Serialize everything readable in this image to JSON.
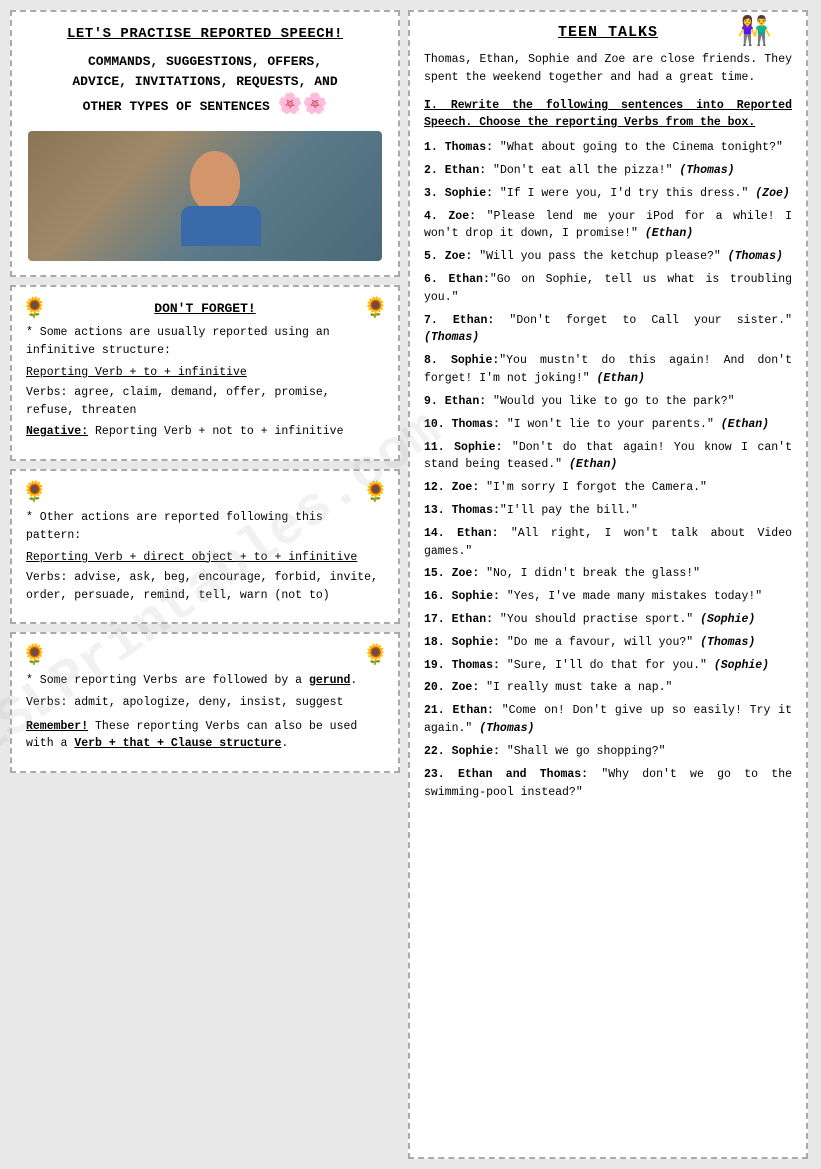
{
  "left": {
    "title": "LET'S PRACTISE REPORTED SPEECH!",
    "subtitle_line1": "COMMANDS, SUGGESTIONS, OFFERS,",
    "subtitle_line2": "ADVICE, INVITATIONS, REQUESTS, AND",
    "subtitle_line3": "OTHER TYPES OF SENTENCES",
    "flowers": "🌸🌸",
    "box1": {
      "title": "DON'T FORGET!",
      "icon": "🌻",
      "para1": "* Some actions are usually reported using an infinitive structure:",
      "rule1": "Reporting Verb + to + infinitive",
      "verbs1": "Verbs: agree, claim, demand, offer, promise, refuse, threaten",
      "negative": "Negative: Reporting Verb +  not to + infinitive"
    },
    "box2": {
      "icon": "🌻",
      "para1": "* Other actions are reported following this pattern:",
      "rule1": "Reporting Verb + direct object + to + infinitive",
      "verbs1": "Verbs: advise, ask, beg, encourage, forbid, invite, order, persuade, remind, tell, warn (not to)"
    },
    "box3": {
      "icon": "🌻",
      "para1": "* Some reporting Verbs are followed by a gerund.",
      "verbs1": "Verbs: admit, apologize, deny, insist, suggest",
      "note": "Remember! These reporting Verbs can also be used with a Verb + that + Clause structure."
    }
  },
  "right": {
    "title": "TEEN TALKS",
    "icon": "👫",
    "intro": "Thomas, Ethan, Sophie and Zoe are close friends. They spent the weekend together and had a great time.",
    "instruction": "I.  Rewrite the following sentences into Reported Speech. Choose the reporting Verbs from the box.",
    "sentences": [
      {
        "num": "1.",
        "speaker": "Thomas:",
        "text": " \"What about going to the Cinema tonight?\""
      },
      {
        "num": "2.",
        "speaker": "Ethan:",
        "text": "  \"Don't eat all the pizza!\" ",
        "recipient": "(Thomas)"
      },
      {
        "num": "3.",
        "speaker": "Sophie:",
        "text": "  \"If I were you, I'd try this dress.\" ",
        "recipient": "(Zoe)"
      },
      {
        "num": "4.",
        "speaker": "Zoe:",
        "text": "  \"Please lend me your iPod for a while! I won't drop it down, I promise!\" ",
        "recipient": "(Ethan)"
      },
      {
        "num": "5.",
        "speaker": "Zoe:",
        "text": "  \"Will you pass the ketchup please?\" ",
        "recipient": "(Thomas)"
      },
      {
        "num": "6.",
        "speaker": "Ethan:",
        "text": "\"Go on Sophie, tell us what is troubling you.\""
      },
      {
        "num": "7.",
        "speaker": "Ethan:",
        "text": "  \"Don't forget to Call your sister.\" ",
        "recipient": "(Thomas)"
      },
      {
        "num": "8.",
        "speaker": "Sophie:",
        "text": "\"You mustn't do this again! And don't forget! I'm not joking!\" ",
        "recipient": "(Ethan)"
      },
      {
        "num": "9.",
        "speaker": "Ethan:",
        "text": "  \"Would you like to go to the park?\""
      },
      {
        "num": "10.",
        "speaker": "Thomas:",
        "text": "  \"I won't lie to your parents.\" ",
        "recipient": "(Ethan)"
      },
      {
        "num": "11.",
        "speaker": "Sophie:",
        "text": "  \"Don't do that again! You know I can't stand being teased.\" ",
        "recipient": "(Ethan)"
      },
      {
        "num": "12.",
        "speaker": "Zoe:",
        "text": "  \"I'm sorry I forgot the Camera.\""
      },
      {
        "num": "13.",
        "speaker": "Thomas:",
        "text": "\"I'll pay the bill.\""
      },
      {
        "num": "14.",
        "speaker": "Ethan:",
        "text": "  \"All right, I won't talk about Video games.\""
      },
      {
        "num": "15.",
        "speaker": "Zoe:",
        "text": "  \"No, I didn't break the glass!\""
      },
      {
        "num": "16.",
        "speaker": "Sophie:",
        "text": "  \"Yes, I've made many mistakes today!\""
      },
      {
        "num": "17.",
        "speaker": "Ethan:",
        "text": "  \"You should practise sport.\" ",
        "recipient": "(Sophie)"
      },
      {
        "num": "18.",
        "speaker": "Sophie:",
        "text": "  \"Do me a favour, will you?\" ",
        "recipient": "(Thomas)"
      },
      {
        "num": "19.",
        "speaker": "Thomas:",
        "text": "  \"Sure, I'll do that for you.\" ",
        "recipient": "(Sophie)"
      },
      {
        "num": "20.",
        "speaker": "Zoe:",
        "text": "  \"I really must take a nap.\""
      },
      {
        "num": "21.",
        "speaker": "Ethan:",
        "text": "  \"Come on! Don't give up so easily! Try it again.\" ",
        "recipient": "(Thomas)"
      },
      {
        "num": "22.",
        "speaker": "Sophie:",
        "text": "  \"Shall we go shopping?\""
      },
      {
        "num": "23.",
        "speaker": "Ethan and Thomas:",
        "text": "  \"Why don't we go to the swimming-pool instead?\""
      }
    ],
    "watermark": "ESLPrintables.com"
  }
}
